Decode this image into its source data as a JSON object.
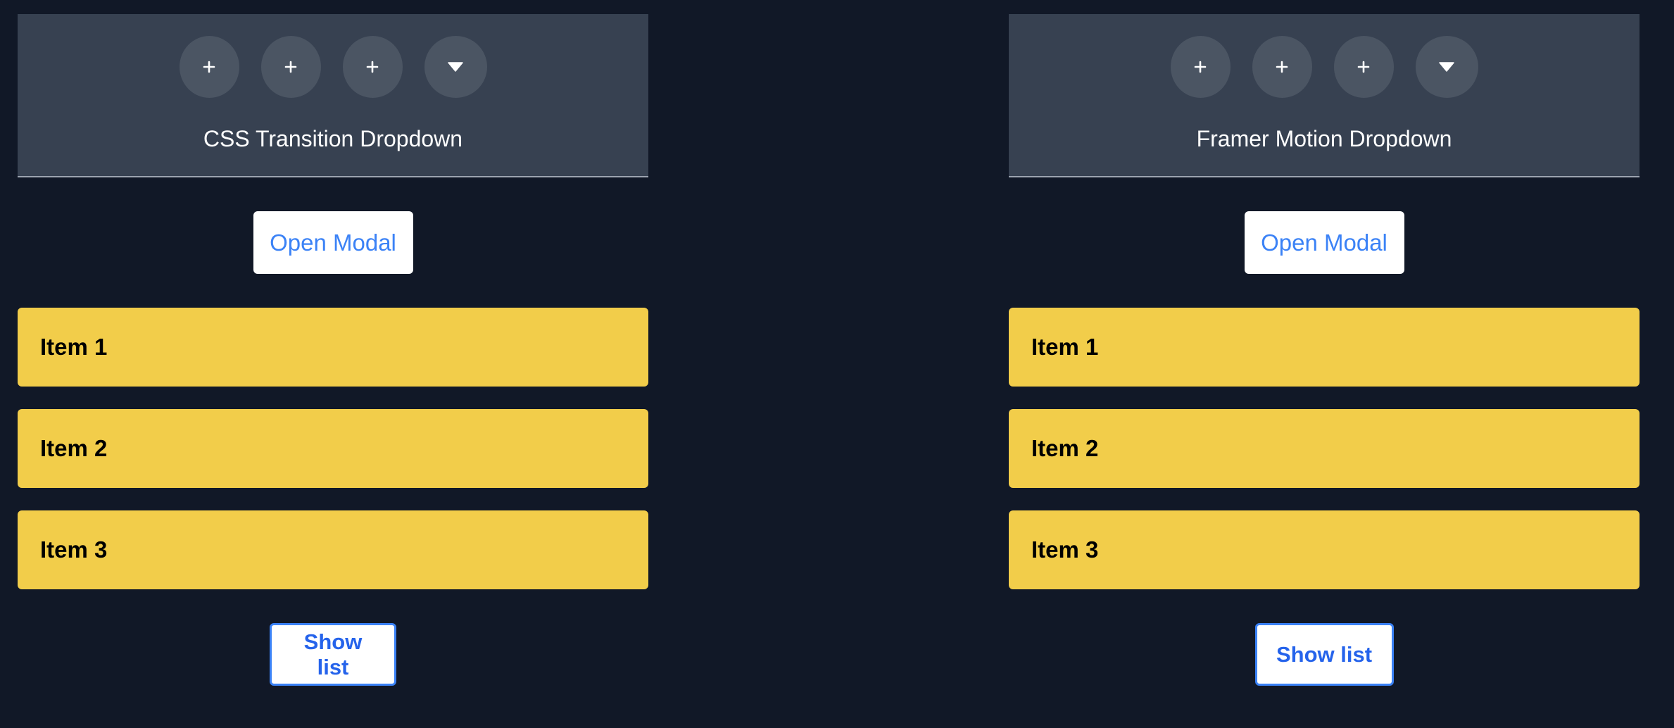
{
  "colors": {
    "page_background": "#111827",
    "panel_background": "#374151",
    "circle_button": "#4b5563",
    "item_background": "#f2cd4a",
    "accent_blue": "#3b82f6"
  },
  "left": {
    "dropdown": {
      "icons": [
        "plus-icon",
        "plus-icon",
        "plus-icon",
        "caret-down-icon"
      ],
      "title": "CSS Transition Dropdown"
    },
    "modal_button": "Open Modal",
    "items": [
      "Item 1",
      "Item 2",
      "Item 3"
    ],
    "show_list_button": "Show list"
  },
  "right": {
    "dropdown": {
      "icons": [
        "plus-icon",
        "plus-icon",
        "plus-icon",
        "caret-down-icon"
      ],
      "title": "Framer Motion Dropdown"
    },
    "modal_button": "Open Modal",
    "items": [
      "Item 1",
      "Item 2",
      "Item 3"
    ],
    "show_list_button": "Show list"
  }
}
